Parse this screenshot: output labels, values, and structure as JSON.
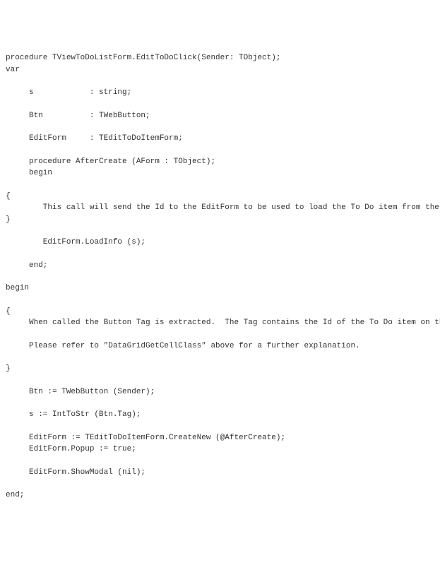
{
  "code": {
    "l01": "procedure TViewToDoListForm.EditToDoClick(Sender: TObject);",
    "l02": "var",
    "l03": "",
    "l04": "     s            : string;",
    "l05": "",
    "l06": "     Btn          : TWebButton;",
    "l07": "",
    "l08": "     EditForm     : TEditToDoItemForm;",
    "l09": "",
    "l10": "     procedure AfterCreate (AForm : TObject);",
    "l11": "     begin",
    "l12": "",
    "l13": "{",
    "l14": "        This call will send the Id to the EditForm to be used to load the To Do item from the database",
    "l15": "}",
    "l16": "",
    "l17": "        EditForm.LoadInfo (s);",
    "l18": "",
    "l19": "     end;",
    "l20": "",
    "l21": "begin",
    "l22": "",
    "l23": "{",
    "l24": "     When called the Button Tag is extracted.  The Tag contains the Id of the To Do item on the table.",
    "l25": "",
    "l26": "     Please refer to \"DataGridGetCellClass\" above for a further explanation.",
    "l27": "",
    "l28": "}",
    "l29": "",
    "l30": "     Btn := TWebButton (Sender);",
    "l31": "",
    "l32": "     s := IntToStr (Btn.Tag);",
    "l33": "",
    "l34": "     EditForm := TEditToDoItemForm.CreateNew (@AfterCreate);",
    "l35": "     EditForm.Popup := true;",
    "l36": "",
    "l37": "     EditForm.ShowModal (nil);",
    "l38": "",
    "l39": "end;"
  }
}
